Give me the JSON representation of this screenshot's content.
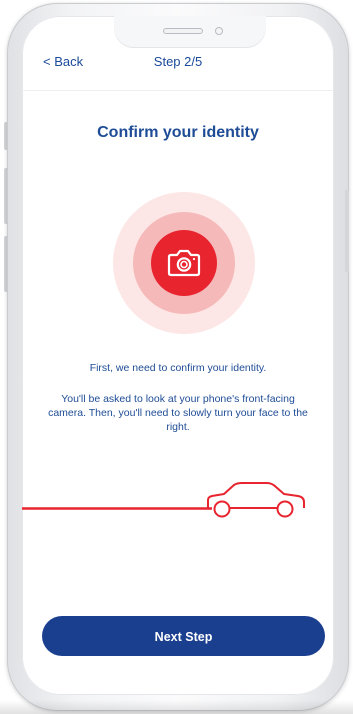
{
  "header": {
    "back_label": "< Back",
    "step_label": "Step 2/5"
  },
  "main": {
    "title": "Confirm your identity",
    "intro_text": "First, we need to confirm your identity.",
    "instructions_text": "You'll be asked to look at your phone's front-facing camera. Then, you'll need to slowly turn your face to the right."
  },
  "footer": {
    "next_label": "Next Step"
  },
  "icons": {
    "camera": "camera-icon",
    "car": "car-icon"
  },
  "colors": {
    "brand_blue": "#1a3f8f",
    "title_blue": "#1e4c96",
    "accent_red": "#e8242f",
    "ring_light": "#fde6e6",
    "ring_mid": "#f6b9b9"
  }
}
